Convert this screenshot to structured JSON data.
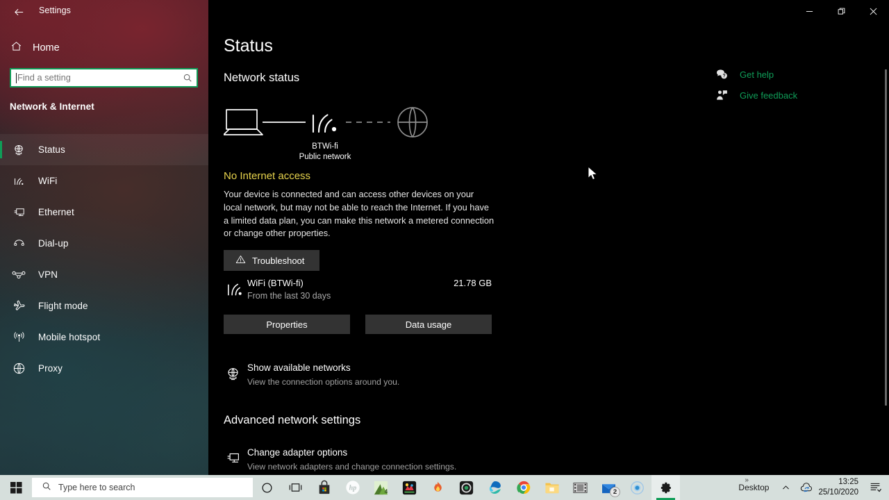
{
  "window": {
    "title": "Settings",
    "back_icon": "back-arrow-icon",
    "minimize_label": "─",
    "restore_label": "❐",
    "close_label": "✕"
  },
  "sidebar": {
    "home_label": "Home",
    "home_icon": "home-icon",
    "search": {
      "placeholder": "Find a setting",
      "value": "",
      "icon": "search-icon"
    },
    "category_title": "Network & Internet",
    "accent_color": "#0f9d58",
    "items": [
      {
        "label": "Status",
        "icon": "status-globe-icon",
        "active": true
      },
      {
        "label": "WiFi",
        "icon": "wifi-icon",
        "active": false
      },
      {
        "label": "Ethernet",
        "icon": "ethernet-icon",
        "active": false
      },
      {
        "label": "Dial-up",
        "icon": "dialup-phone-icon",
        "active": false
      },
      {
        "label": "VPN",
        "icon": "vpn-icon",
        "active": false
      },
      {
        "label": "Flight mode",
        "icon": "airplane-icon",
        "active": false
      },
      {
        "label": "Mobile hotspot",
        "icon": "hotspot-icon",
        "active": false
      },
      {
        "label": "Proxy",
        "icon": "globe-icon",
        "active": false
      }
    ]
  },
  "main": {
    "page_title": "Status",
    "network_status_heading": "Network status",
    "diagram": {
      "device_icon": "laptop-icon",
      "connection_icon": "wifi-icon",
      "internet_icon": "globe-icon",
      "network_name": "BTWi-fi",
      "network_type": "Public network",
      "device_link_state": "connected",
      "internet_link_state": "disconnected"
    },
    "status_headline": "No Internet access",
    "status_headline_color": "#e8d44d",
    "status_description": "Your device is connected and can access other devices on your local network, but may not be able to reach the Internet. If you have a limited data plan, you can make this network a metered connection or change other properties.",
    "troubleshoot_button": {
      "label": "Troubleshoot",
      "icon": "warning-triangle-icon"
    },
    "data_usage": {
      "icon": "wifi-icon",
      "adapter": "WiFi (BTWi-fi)",
      "period": "From the last 30 days",
      "amount": "21.78 GB"
    },
    "properties_button": "Properties",
    "data_usage_button": "Data usage",
    "show_networks": {
      "icon": "globe-icon",
      "title": "Show available networks",
      "subtitle": "View the connection options around you."
    },
    "advanced_heading": "Advanced network settings",
    "change_adapter": {
      "icon": "ethernet-icon",
      "title": "Change adapter options",
      "subtitle": "View network adapters and change connection settings."
    }
  },
  "help": {
    "link_color": "#0f9d58",
    "items": [
      {
        "label": "Get help",
        "icon": "help-chat-icon"
      },
      {
        "label": "Give feedback",
        "icon": "feedback-person-icon"
      }
    ]
  },
  "taskbar": {
    "start_icon": "windows-logo-icon",
    "search_placeholder": "Type here to search",
    "search_icon": "search-icon",
    "items": [
      {
        "name": "cortana-icon",
        "label": ""
      },
      {
        "name": "task-view-icon",
        "label": ""
      },
      {
        "name": "microsoft-store-icon",
        "label": ""
      },
      {
        "name": "hp-icon",
        "label": ""
      },
      {
        "name": "green-app-icon",
        "label": ""
      },
      {
        "name": "colorful-app-icon",
        "label": ""
      },
      {
        "name": "flame-app-icon",
        "label": ""
      },
      {
        "name": "dark-circle-app-icon",
        "label": ""
      },
      {
        "name": "microsoft-edge-icon",
        "label": ""
      },
      {
        "name": "google-chrome-icon",
        "label": ""
      },
      {
        "name": "file-explorer-icon",
        "label": ""
      },
      {
        "name": "media-film-icon",
        "label": ""
      },
      {
        "name": "mail-icon",
        "label": "",
        "badge": "2"
      },
      {
        "name": "recorder-icon",
        "label": ""
      },
      {
        "name": "settings-gear-icon",
        "label": "",
        "active": true
      }
    ],
    "tray": {
      "desktop_label": "Desktop",
      "overflow_icon": "chevron-up-icon",
      "cloud_icon": "cloud-sync-icon",
      "time": "13:25",
      "date": "25/10/2020",
      "action_center_icon": "action-center-icon"
    }
  }
}
